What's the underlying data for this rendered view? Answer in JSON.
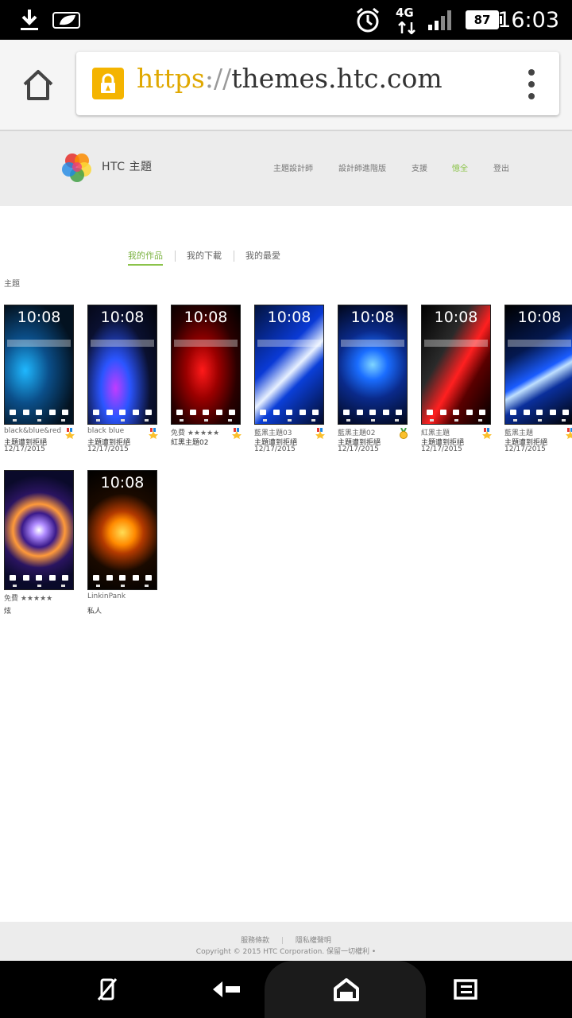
{
  "status_bar": {
    "time": "16:03",
    "battery": "87",
    "network": "4G",
    "icons": [
      "download-icon",
      "leaf-icon",
      "alarm-icon",
      "network-4g-icon",
      "signal-icon",
      "battery-icon"
    ]
  },
  "browser": {
    "url_scheme": "https",
    "url_sep": "://",
    "url_host": "themes.htc.com",
    "lock_color": "#f4b400"
  },
  "site": {
    "brand": "HTC 主題",
    "nav": [
      "主題設計師",
      "設計師進階版",
      "支援",
      "憶全",
      "登出"
    ],
    "nav_active_color": "#8bc34a"
  },
  "tabs": [
    "我的作品",
    "我的下載",
    "我的最愛"
  ],
  "section_label": "主題",
  "themes": [
    {
      "title": "black&blue&red",
      "status": "主題遭到拒絕",
      "date": "12/17/2015",
      "clock": "10:08",
      "award": "trophy-icon"
    },
    {
      "title": "black blue",
      "status": "主題遭到拒絕",
      "date": "12/17/2015",
      "clock": "10:08",
      "award": "trophy-icon"
    },
    {
      "title": "免費 ★★★★★",
      "status": "紅黑主題02",
      "date": "",
      "clock": "10:08",
      "award": "trophy-icon"
    },
    {
      "title": "藍黑主題03",
      "status": "主題遭到拒絕",
      "date": "12/17/2015",
      "clock": "10:08",
      "award": "trophy-icon"
    },
    {
      "title": "藍黑主題02",
      "status": "主題遭到拒絕",
      "date": "12/17/2015",
      "clock": "10:08",
      "award": "medal-icon"
    },
    {
      "title": "紅黑主題",
      "status": "主題遭到拒絕",
      "date": "12/17/2015",
      "clock": "10:08",
      "award": "trophy-icon"
    },
    {
      "title": "藍黑主題",
      "status": "主題遭到拒絕",
      "date": "12/17/2015",
      "clock": "10:08",
      "award": "trophy-icon"
    },
    {
      "title": "免費 ★★★★★",
      "status": "炫",
      "date": "",
      "clock": "",
      "award": ""
    },
    {
      "title": "LinkinPank",
      "status": "私人",
      "date": "",
      "clock": "10:08",
      "award": ""
    }
  ],
  "footer": {
    "terms": "服務條款",
    "privacy": "隱私權聲明",
    "copyright": "Copyright © 2015 HTC Corporation. 保留一切權利 •"
  },
  "nav_bar": {
    "icons": [
      "rotate-icon",
      "back-icon",
      "home-icon",
      "recents-icon"
    ]
  }
}
